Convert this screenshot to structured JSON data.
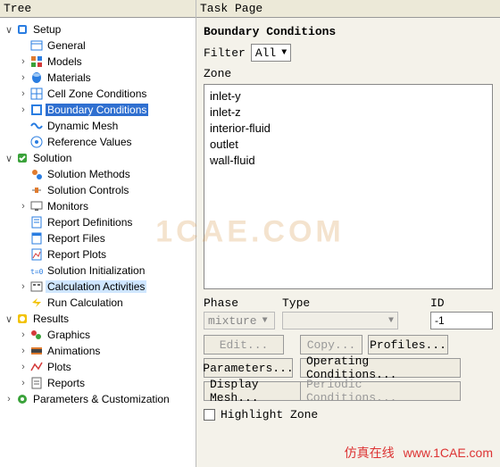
{
  "left_title": "Tree",
  "right_title": "Task Page",
  "tree": {
    "setup": {
      "label": "Setup",
      "children": {
        "general": "General",
        "models": "Models",
        "materials": "Materials",
        "cell_zone": "Cell Zone Conditions",
        "boundary": "Boundary Conditions",
        "dyn_mesh": "Dynamic Mesh",
        "ref_values": "Reference Values"
      }
    },
    "solution": {
      "label": "Solution",
      "children": {
        "methods": "Solution Methods",
        "controls": "Solution Controls",
        "monitors": "Monitors",
        "rep_defs": "Report Definitions",
        "rep_files": "Report Files",
        "rep_plots": "Report Plots",
        "init": "Solution Initialization",
        "calc": "Calculation Activities",
        "run": "Run Calculation"
      }
    },
    "results": {
      "label": "Results",
      "children": {
        "graphics": "Graphics",
        "animations": "Animations",
        "plots": "Plots",
        "reports": "Reports"
      }
    },
    "params": "Parameters & Customization"
  },
  "task": {
    "heading": "Boundary Conditions",
    "filter_label": "Filter",
    "filter_value": "All",
    "zone_label": "Zone",
    "zones": [
      "inlet-y",
      "inlet-z",
      "interior-fluid",
      "outlet",
      "wall-fluid"
    ],
    "phase_label": "Phase",
    "phase_value": "mixture",
    "type_label": "Type",
    "type_value": "",
    "id_label": "ID",
    "id_value": "-1",
    "buttons": {
      "edit": "Edit...",
      "copy": "Copy...",
      "profiles": "Profiles...",
      "parameters": "Parameters...",
      "operating": "Operating Conditions...",
      "display_mesh": "Display Mesh...",
      "periodic": "Periodic Conditions..."
    },
    "highlight_label": "Highlight Zone"
  },
  "overlay": {
    "watermark": "1CAE.COM",
    "cn": "仿真在线",
    "url": "www.1CAE.com"
  }
}
